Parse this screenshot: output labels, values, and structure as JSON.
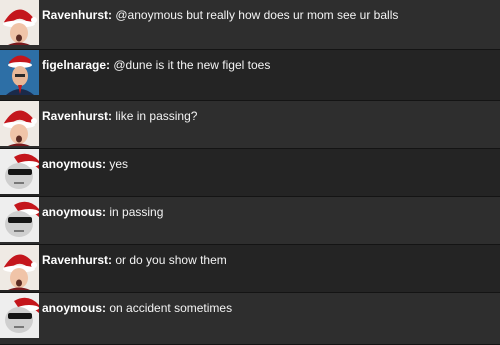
{
  "messages": [
    {
      "user": "Ravenhurst",
      "text": "@anoymous but really how does ur mom see ur balls",
      "avatar": "ravenhurst-avatar"
    },
    {
      "user": "figelnarage",
      "text": "@dune is it the new figel toes",
      "avatar": "figelnarage-avatar"
    },
    {
      "user": "Ravenhurst",
      "text": "like in passing?",
      "avatar": "ravenhurst-avatar"
    },
    {
      "user": "anoymous",
      "text": "yes",
      "avatar": "anoymous-avatar"
    },
    {
      "user": "anoymous",
      "text": "in passing",
      "avatar": "anoymous-avatar"
    },
    {
      "user": "Ravenhurst",
      "text": "or do you show them",
      "avatar": "ravenhurst-avatar"
    },
    {
      "user": "anoymous",
      "text": "on accident sometimes",
      "avatar": "anoymous-avatar"
    }
  ],
  "separator": ": ",
  "colors": {
    "row_odd": "#2e2e2e",
    "row_even": "#242424",
    "text": "#f4f4f4",
    "username": "#ffffff"
  }
}
